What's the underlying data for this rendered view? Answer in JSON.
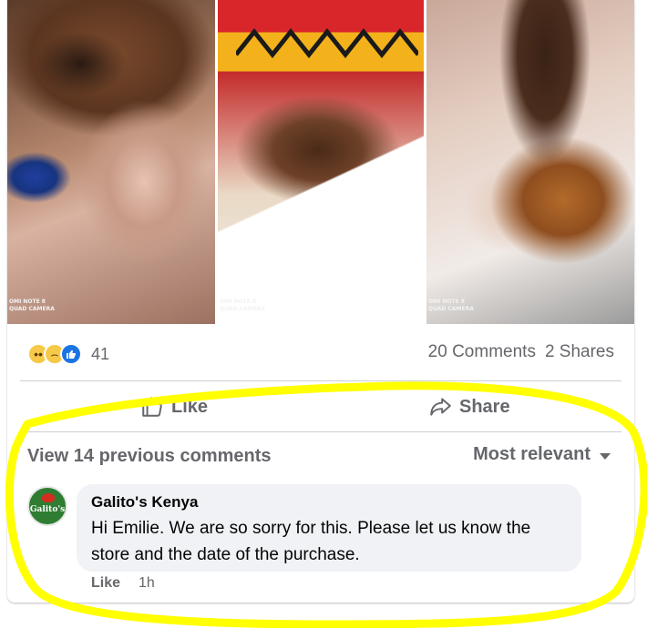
{
  "photos": {
    "camera_watermark_line1": "OMI NOTE 8",
    "camera_watermark_line2": "QUAD CAMERA"
  },
  "reactions": {
    "types": [
      "wow",
      "sad",
      "like"
    ],
    "count": "41",
    "comments": "20 Comments",
    "shares": "2 Shares"
  },
  "actions": {
    "like_label": "Like",
    "share_label": "Share"
  },
  "comments_section": {
    "view_previous": "View 14 previous comments",
    "sort_label": "Most relevant"
  },
  "comment": {
    "author": "Galito's Kenya",
    "avatar_text": "Galito's",
    "text": "Hi Emilie. We are so sorry for this. Please let us know the store and the date of the purchase.",
    "like_label": "Like",
    "time": "1h"
  },
  "colors": {
    "highlight": "#ffff00",
    "secondary_text": "#65676b",
    "bubble_bg": "#f0f2f5",
    "like_blue": "#1b74e4"
  }
}
